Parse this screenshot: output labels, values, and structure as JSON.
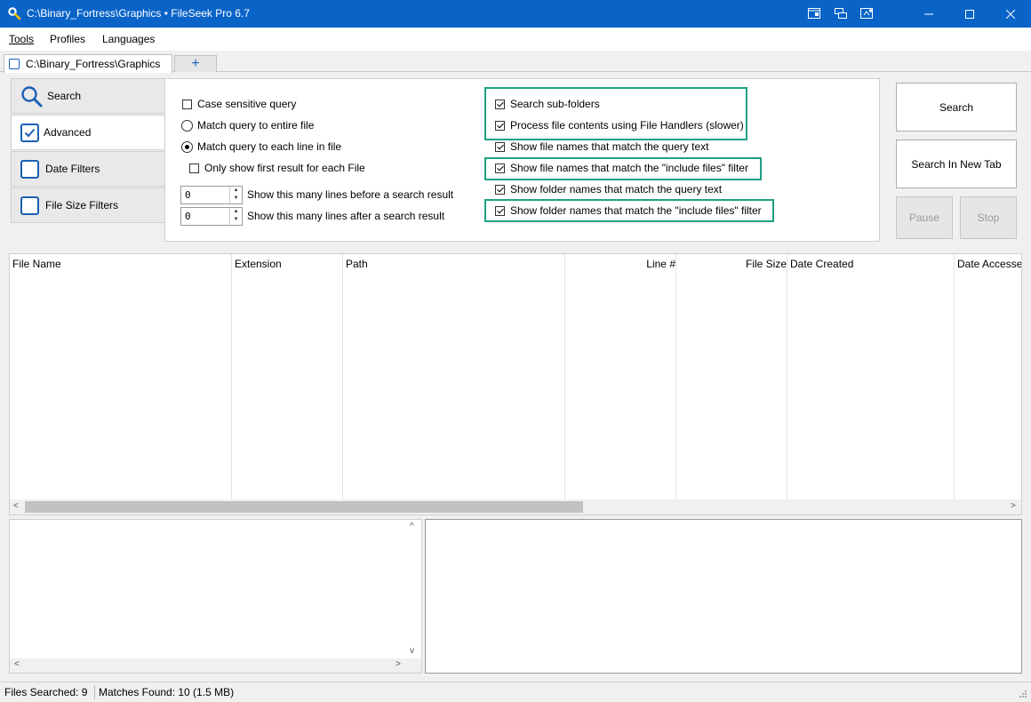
{
  "window": {
    "title": "C:\\Binary_Fortress\\Graphics • FileSeek Pro 6.7",
    "title_bar_color": "#0a64c8"
  },
  "menu": {
    "items": [
      "Tools",
      "Profiles",
      "Languages"
    ]
  },
  "tabs": {
    "current": "C:\\Binary_Fortress\\Graphics",
    "new_tab_glyph": "+"
  },
  "side_tabs": {
    "search": "Search",
    "advanced": "Advanced",
    "date_filters": "Date Filters",
    "file_size_filters": "File Size Filters"
  },
  "options": {
    "case_sensitive": {
      "label": "Case sensitive query",
      "checked": false
    },
    "match_entire": {
      "label": "Match query to entire file",
      "selected": false
    },
    "match_each_line": {
      "label": "Match query to each line in file",
      "selected": true
    },
    "first_result_only": {
      "label": "Only show first result for each File",
      "checked": false
    },
    "lines_before": {
      "value": "0",
      "label": "Show this many lines before a search result"
    },
    "lines_after": {
      "value": "0",
      "label": "Show this many lines after a search result"
    },
    "search_subfolders": {
      "label": "Search sub-folders",
      "checked": true
    },
    "file_handlers": {
      "label": "Process file contents using File Handlers (slower)",
      "checked": true
    },
    "file_names_query": {
      "label": "Show file names that match the query text",
      "checked": true
    },
    "file_names_include": {
      "label": "Show file names that match the \"include files\" filter",
      "checked": true
    },
    "folder_names_query": {
      "label": "Show folder names that match the query text",
      "checked": true
    },
    "folder_names_include": {
      "label": "Show folder names that match the \"include files\" filter",
      "checked": true
    },
    "highlight_color": "#1fa085"
  },
  "buttons": {
    "search": "Search",
    "search_new_tab": "Search In New Tab",
    "pause": "Pause",
    "stop": "Stop"
  },
  "grid": {
    "columns": [
      "File Name",
      "Extension",
      "Path",
      "Line #",
      "File Size",
      "Date Created",
      "Date Accessed"
    ]
  },
  "status": {
    "files_searched": "Files Searched: 9",
    "matches_found": "Matches Found: 10 (1.5 MB)"
  }
}
